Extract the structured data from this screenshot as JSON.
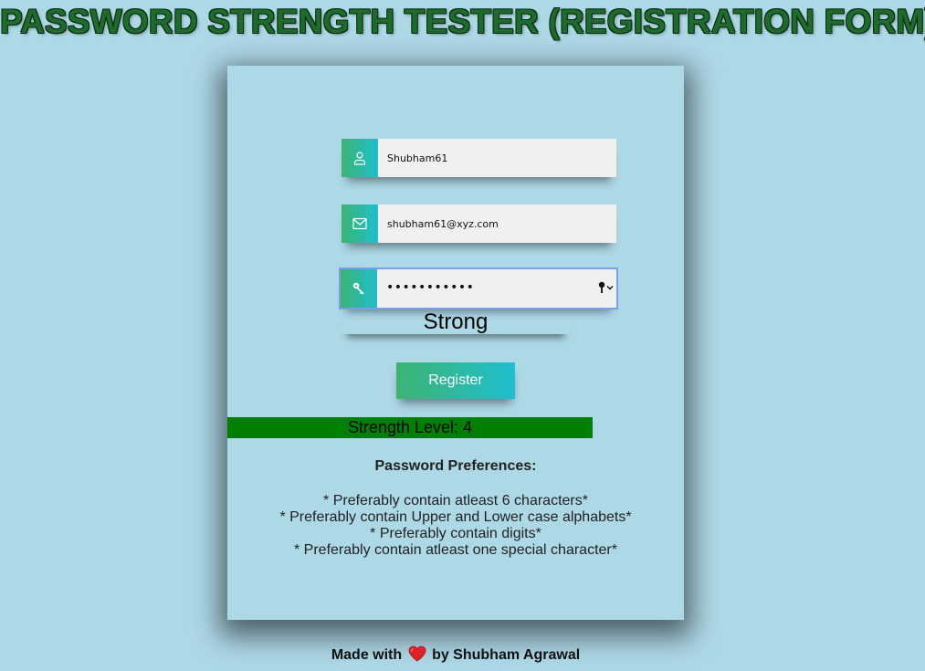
{
  "header": {
    "title": "PASSWORD STRENGTH TESTER (REGISTRATION FORM)"
  },
  "form": {
    "username": {
      "value": "Shubham61",
      "icon": "user-icon"
    },
    "email": {
      "value": "shubham61@xyz.com",
      "icon": "envelope-icon"
    },
    "password": {
      "masked_value": "•••••••••••",
      "icon": "key-icon",
      "manager_icon": "key-dropdown-icon"
    },
    "strength_label": "Strong",
    "register_label": "Register"
  },
  "strength": {
    "text": "Strength Level: 4",
    "level": 4,
    "max_level": 5,
    "color": "#008000"
  },
  "preferences": {
    "heading": "Password Preferences:",
    "items": [
      "* Preferably contain atleast 6 characters*",
      "* Preferably contain Upper and Lower case alphabets*",
      "* Preferably contain digits*",
      "* Preferably contain atleast one special character*"
    ]
  },
  "footer": {
    "prefix": "Made with",
    "suffix": "by Shubham Agrawal",
    "heart_icon": "heart-icon"
  },
  "colors": {
    "background": "#add8e6",
    "title": "#1e6b2c",
    "gradient_start": "#3cb371",
    "gradient_end": "#1fbfcf",
    "focus_ring": "#7a9ee8"
  }
}
